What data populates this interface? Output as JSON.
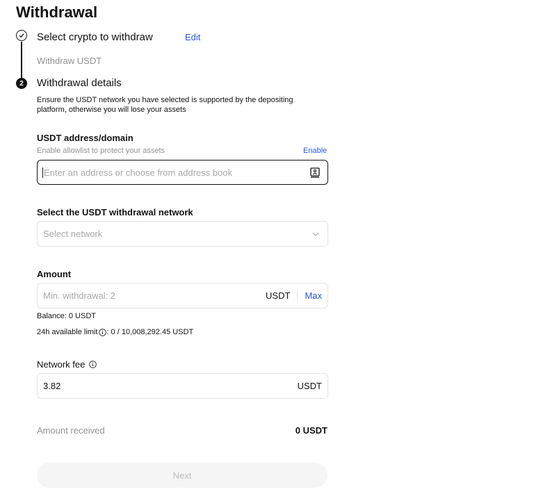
{
  "page": {
    "title": "Withdrawal"
  },
  "step1": {
    "title": "Select crypto to withdraw",
    "edit_label": "Edit",
    "summary": "Withdraw USDT"
  },
  "step2": {
    "number": "2",
    "title": "Withdrawal details",
    "notice_line1": "Ensure the USDT network you have selected is supported by the depositing",
    "notice_line2": "platform, otherwise you will lose your assets"
  },
  "address": {
    "label": "USDT address/domain",
    "hint": "Enable allowlist to protect your assets",
    "enable_label": "Enable",
    "placeholder": "Enter an address or choose from address book",
    "value": ""
  },
  "network": {
    "label": "Select the USDT withdrawal network",
    "placeholder": "Select network"
  },
  "amount": {
    "label": "Amount",
    "placeholder": "Min. withdrawal: 2",
    "unit": "USDT",
    "max_label": "Max",
    "balance": "Balance: 0 USDT",
    "limit_label": "24h available limit",
    "limit_value": ": 0 / 10,008,292.45 USDT"
  },
  "fee": {
    "label": "Network fee",
    "value": "3.82",
    "unit": "USDT"
  },
  "received": {
    "label": "Amount received",
    "value": "0 USDT"
  },
  "next_label": "Next",
  "colors": {
    "accent": "#2a59d9",
    "text": "#121212",
    "muted": "#929292",
    "border": "#e3e3e3",
    "disabled_bg": "#f5f5f5"
  },
  "icons": {
    "step_done": "check-circle-icon",
    "address_book": "address-book-icon",
    "dropdown": "chevron-down-icon",
    "info": "info-icon"
  }
}
